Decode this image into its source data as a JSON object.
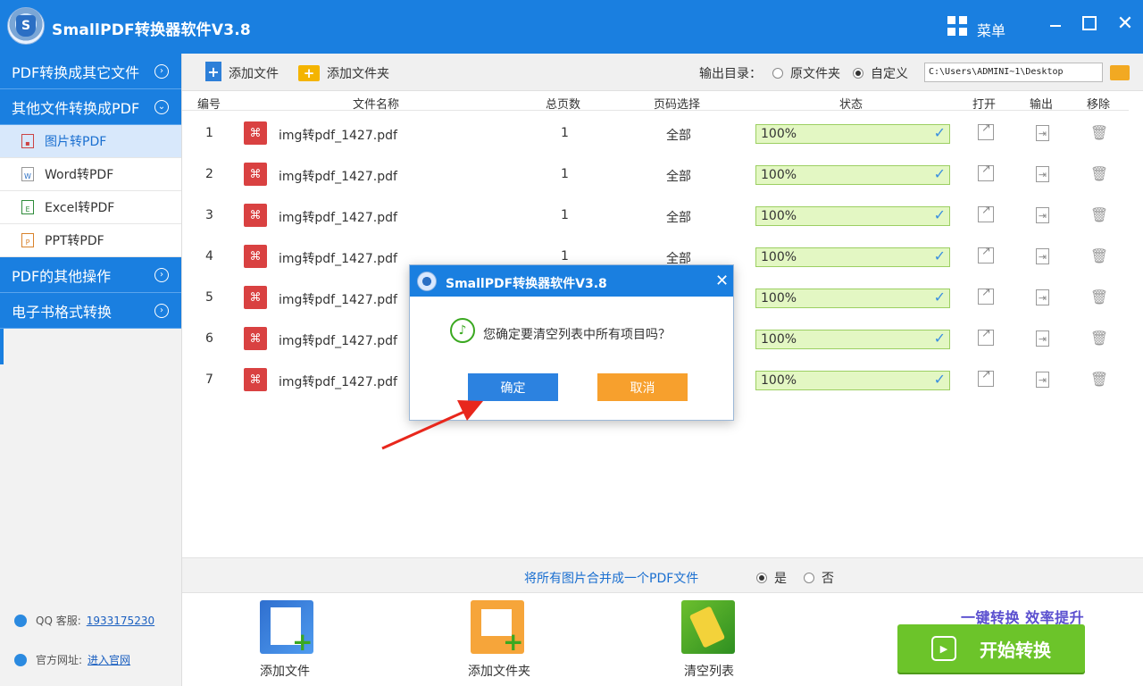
{
  "app": {
    "title": "SmallPDF转换器软件V3.8",
    "logo_letter": "S",
    "menu_label": "菜单",
    "close_glyph": "✕"
  },
  "sidebar": {
    "categories": [
      {
        "label": "PDF转换成其它文件",
        "chevron": "›"
      },
      {
        "label": "其他文件转换成PDF",
        "chevron": "⌄"
      },
      {
        "label": "PDF的其他操作",
        "chevron": "›"
      },
      {
        "label": "电子书格式转换",
        "chevron": "›"
      }
    ],
    "subitems": [
      {
        "label": "图片转PDF",
        "icon_char": "▪"
      },
      {
        "label": "Word转PDF",
        "icon_char": "W"
      },
      {
        "label": "Excel转PDF",
        "icon_char": "E"
      },
      {
        "label": "PPT转PDF",
        "icon_char": "P"
      }
    ],
    "qq_label": "QQ 客服:",
    "qq_number": "1933175230",
    "site_label": "官方网址:",
    "site_link": "进入官网"
  },
  "toolbar": {
    "add_file": "添加文件",
    "add_folder": "添加文件夹",
    "output_label": "输出目录：",
    "opt_original": "原文件夹",
    "opt_custom": "自定义",
    "output_path": "C:\\Users\\ADMINI~1\\Desktop",
    "selected_output": "custom"
  },
  "table": {
    "headers": {
      "no": "编号",
      "name": "文件名称",
      "pages": "总页数",
      "range": "页码选择",
      "status": "状态",
      "open": "打开",
      "output": "输出",
      "remove": "移除"
    },
    "rows": [
      {
        "no": "1",
        "name": "img转pdf_1427.pdf",
        "pages": "1",
        "range": "全部",
        "status": "100%"
      },
      {
        "no": "2",
        "name": "img转pdf_1427.pdf",
        "pages": "1",
        "range": "全部",
        "status": "100%"
      },
      {
        "no": "3",
        "name": "img转pdf_1427.pdf",
        "pages": "1",
        "range": "全部",
        "status": "100%"
      },
      {
        "no": "4",
        "name": "img转pdf_1427.pdf",
        "pages": "1",
        "range": "全部",
        "status": "100%"
      },
      {
        "no": "5",
        "name": "img转pdf_1427.pdf",
        "pages": "",
        "range": "",
        "status": "100%"
      },
      {
        "no": "6",
        "name": "img转pdf_1427.pdf",
        "pages": "",
        "range": "",
        "status": "100%"
      },
      {
        "no": "7",
        "name": "img转pdf_1427.pdf",
        "pages": "",
        "range": "",
        "status": "100%"
      }
    ]
  },
  "merge": {
    "text": "将所有图片合并成一个PDF文件",
    "yes": "是",
    "no": "否",
    "selected": "yes"
  },
  "actions": {
    "add_file": "添加文件",
    "add_folder": "添加文件夹",
    "clear_list": "清空列表",
    "slogan": "一键转换  效率提升",
    "start": "开始转换"
  },
  "dialog": {
    "title": "SmallPDF转换器软件V3.8",
    "message": "您确定要清空列表中所有项目吗？",
    "ok": "确定",
    "cancel": "取消"
  },
  "colors": {
    "brand_blue": "#1a7fe0",
    "progress_fill": "#e3f7c3",
    "start_green": "#6cc42a",
    "cancel_orange": "#f7a02d",
    "annotation_red": "#e8271c"
  }
}
